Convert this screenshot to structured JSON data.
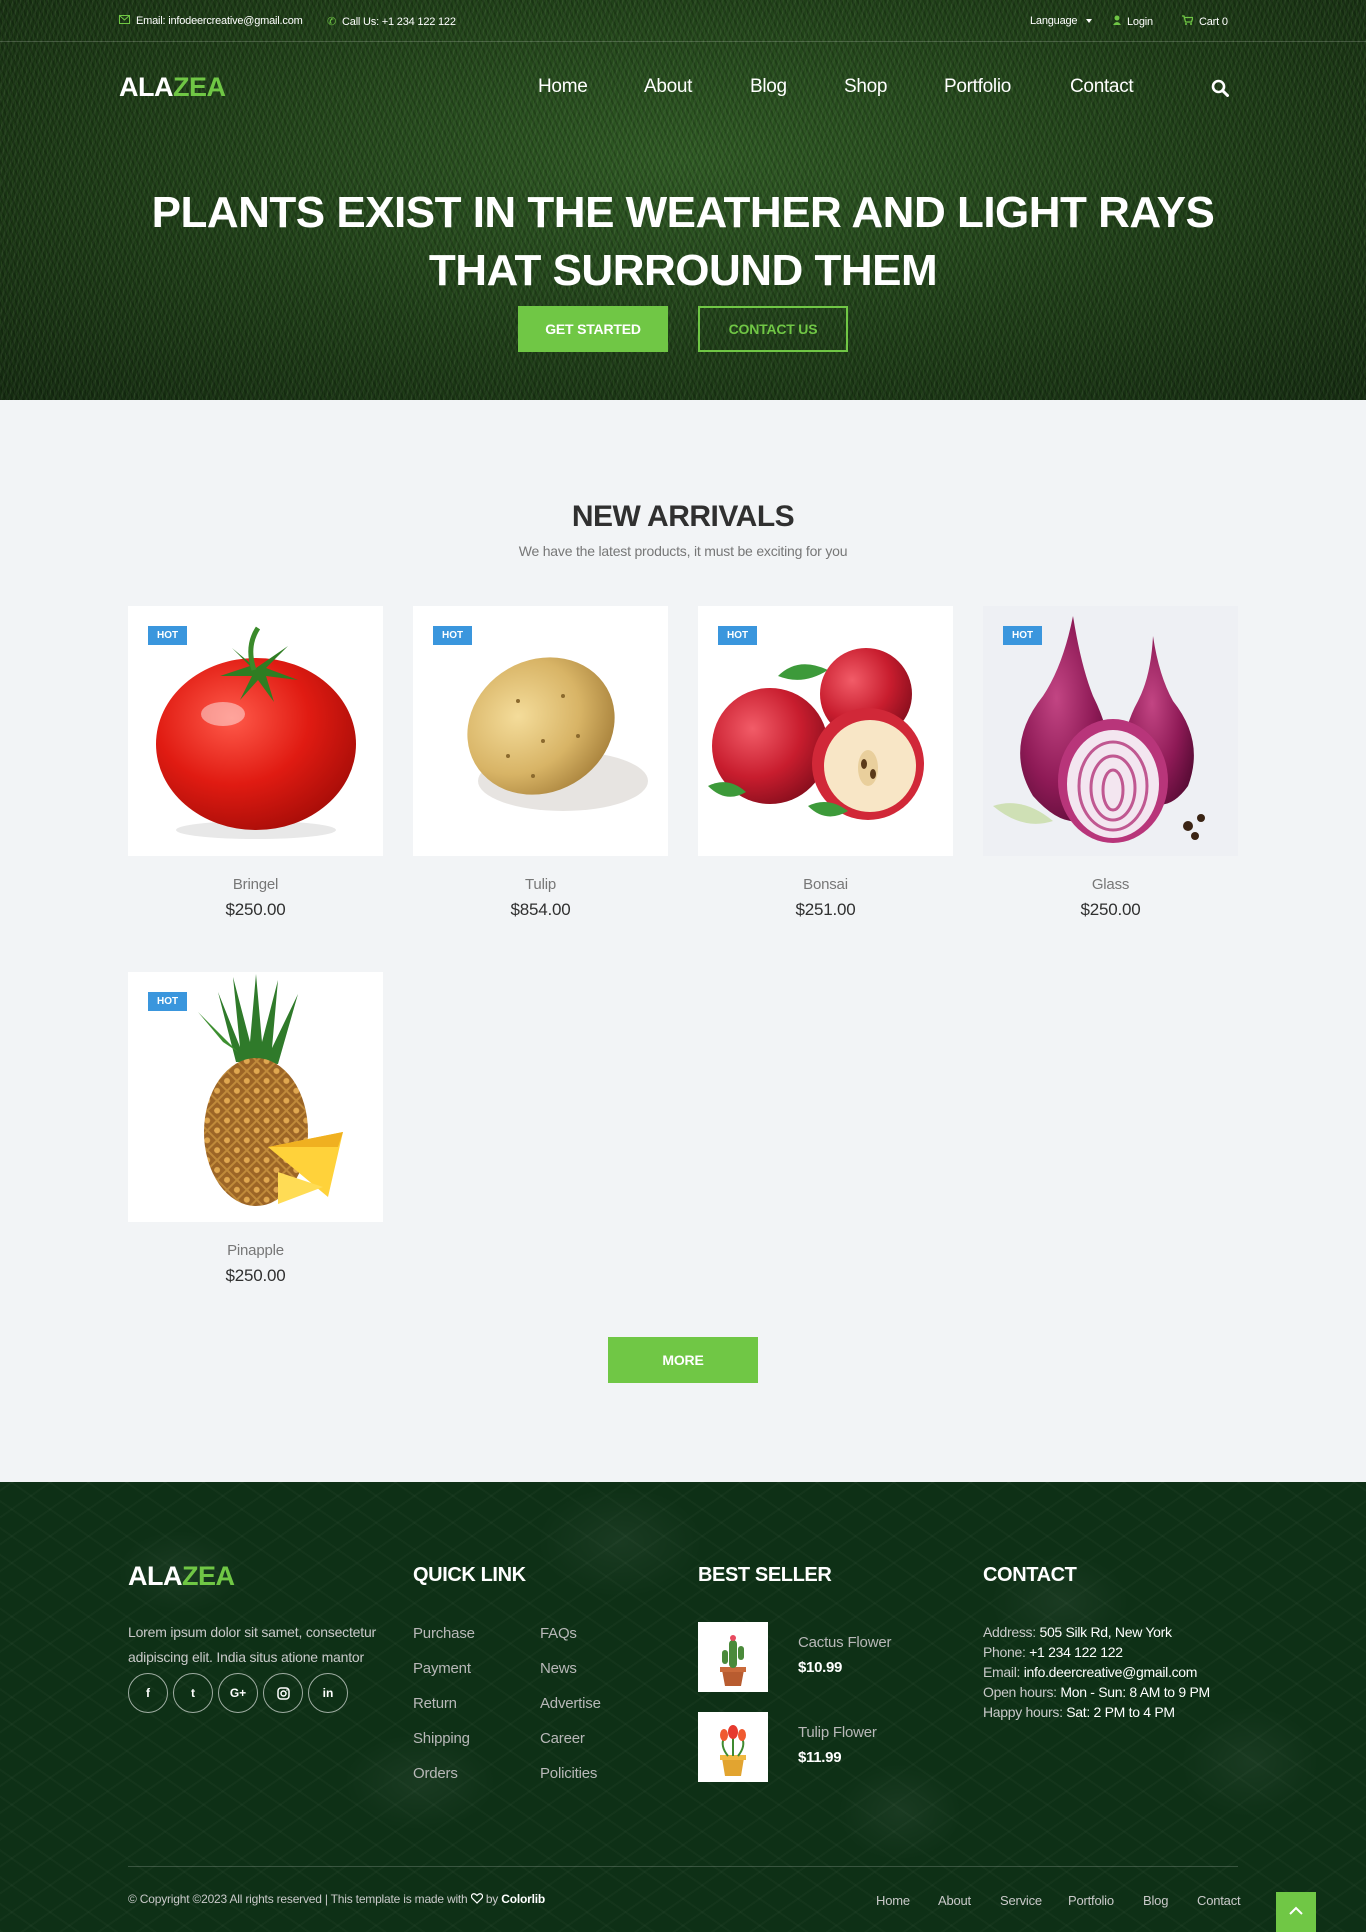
{
  "topbar": {
    "email": "Email: infodeercreative@gmail.com",
    "phone": "Call Us: +1 234 122 122",
    "language": "Language",
    "login": "Login",
    "cart": "Cart 0"
  },
  "brand": {
    "part1": "ALA",
    "part2": "ZEA"
  },
  "nav": [
    "Home",
    "About",
    "Blog",
    "Shop",
    "Portfolio",
    "Contact"
  ],
  "hero": {
    "title": "PLANTS EXIST IN THE WEATHER AND LIGHT RAYS THAT SURROUND THEM",
    "primary_button": "GET STARTED",
    "secondary_button": "CONTACT US"
  },
  "arrivals": {
    "title": "NEW ARRIVALS",
    "subtitle": "We have the latest products, it must be exciting for you",
    "badge": "HOT",
    "products": [
      {
        "name": "Bringel",
        "price": "$250.00",
        "image": "tomato"
      },
      {
        "name": "Tulip",
        "price": "$854.00",
        "image": "potato"
      },
      {
        "name": "Bonsai",
        "price": "$251.00",
        "image": "apples"
      },
      {
        "name": "Glass",
        "price": "$250.00",
        "image": "red-onions"
      },
      {
        "name": "Pinapple",
        "price": "$250.00",
        "image": "pineapple"
      }
    ],
    "more_button": "MORE"
  },
  "footer": {
    "about_text": "Lorem ipsum dolor sit samet, consectetur adipiscing elit. India situs atione mantor",
    "social": [
      {
        "icon": "facebook-icon",
        "glyph": "f"
      },
      {
        "icon": "twitter-icon",
        "glyph": "t"
      },
      {
        "icon": "google-plus-icon",
        "glyph": "G+"
      },
      {
        "icon": "instagram-icon",
        "glyph": ""
      },
      {
        "icon": "linkedin-icon",
        "glyph": "in"
      }
    ],
    "quick_link_title": "QUICK LINK",
    "quick_links_col1": [
      "Purchase",
      "Payment",
      "Return",
      "Shipping",
      "Orders"
    ],
    "quick_links_col2": [
      "FAQs",
      "News",
      "Advertise",
      "Career",
      "Policities"
    ],
    "best_seller_title": "BEST SELLER",
    "best_sellers": [
      {
        "name": "Cactus Flower",
        "price": "$10.99"
      },
      {
        "name": "Tulip Flower",
        "price": "$11.99"
      }
    ],
    "contact_title": "CONTACT",
    "contact": [
      {
        "label": "Address:",
        "value": "505 Silk Rd, New York"
      },
      {
        "label": "Phone:",
        "value": "+1 234 122 122"
      },
      {
        "label": "Email:",
        "value": "info.deercreative@gmail.com"
      },
      {
        "label": "Open hours:",
        "value": "Mon - Sun: 8 AM to 9 PM"
      },
      {
        "label": "Happy hours:",
        "value": "Sat: 2 PM to 4 PM"
      }
    ],
    "copyright": "© Copyright ©2023 All rights reserved | This template is made with",
    "copyright_by": "by",
    "copyright_brand": "Colorlib",
    "bottom_links": [
      "Home",
      "About",
      "Service",
      "Portfolio",
      "Blog",
      "Contact"
    ]
  },
  "colors": {
    "accent": "#70c745",
    "badge": "#3a96dd",
    "footer_bg": "#0e3016"
  }
}
